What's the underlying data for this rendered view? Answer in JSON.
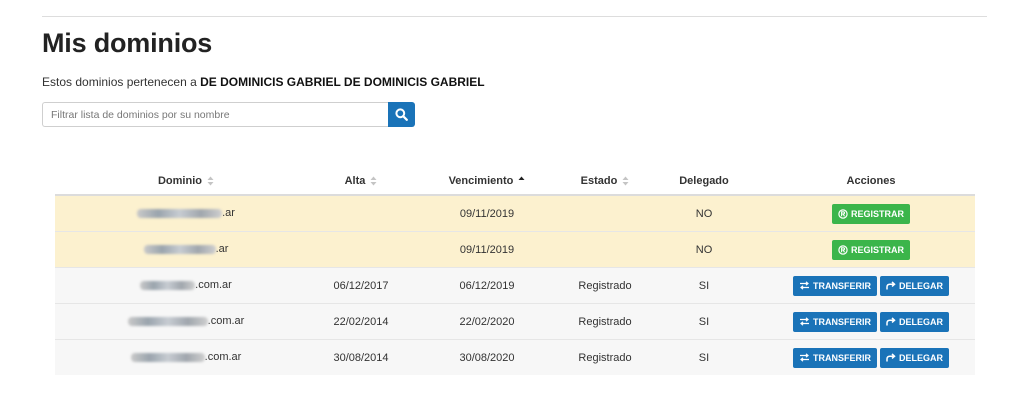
{
  "page": {
    "title": "Mis dominios",
    "owner_prefix": "Estos dominios pertenecen a",
    "owner_name": "DE DOMINICIS GABRIEL DE DOMINICIS GABRIEL"
  },
  "search": {
    "placeholder": "Filtrar lista de dominios por su nombre",
    "value": ""
  },
  "table": {
    "headers": {
      "domain": "Dominio",
      "alta": "Alta",
      "vencimiento": "Vencimiento",
      "estado": "Estado",
      "delegado": "Delegado",
      "acciones": "Acciones"
    },
    "rows": [
      {
        "domain_suffix": ".ar",
        "alta": "",
        "vencimiento": "09/11/2019",
        "estado": "",
        "delegado": "NO",
        "action": "REGISTRAR"
      },
      {
        "domain_suffix": ".ar",
        "alta": "",
        "vencimiento": "09/11/2019",
        "estado": "",
        "delegado": "NO",
        "action": "REGISTRAR"
      },
      {
        "domain_suffix": ".com.ar",
        "alta": "06/12/2017",
        "vencimiento": "06/12/2019",
        "estado": "Registrado",
        "delegado": "SI",
        "action_transfer": "TRANSFERIR",
        "action_delegate": "DELEGAR"
      },
      {
        "domain_suffix": ".com.ar",
        "alta": "22/02/2014",
        "vencimiento": "22/02/2020",
        "estado": "Registrado",
        "delegado": "SI",
        "action_transfer": "TRANSFERIR",
        "action_delegate": "DELEGAR"
      },
      {
        "domain_suffix": ".com.ar",
        "alta": "30/08/2014",
        "vencimiento": "30/08/2020",
        "estado": "Registrado",
        "delegado": "SI",
        "action_transfer": "TRANSFERIR",
        "action_delegate": "DELEGAR"
      }
    ]
  },
  "colors": {
    "primary": "#1a73b8",
    "success": "#3bb54a",
    "pending_row": "#fcf1cf",
    "registered_row": "#f7f7f7"
  },
  "icons": {
    "search": "search-icon",
    "registered": "registered-icon",
    "transfer": "transfer-icon",
    "delegate": "delegate-icon"
  }
}
